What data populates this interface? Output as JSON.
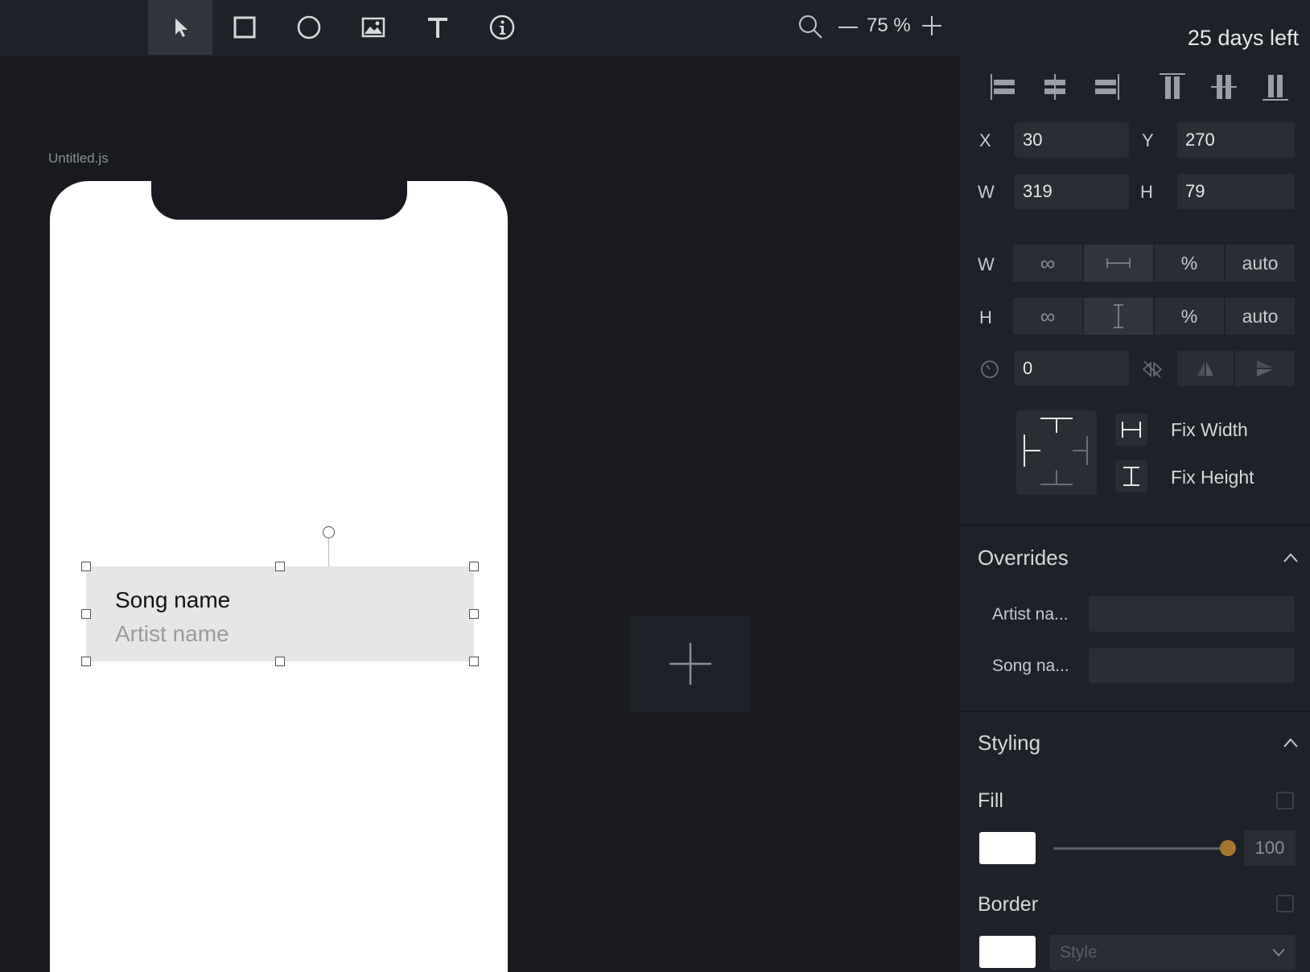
{
  "toolbar": {
    "tools": [
      {
        "name": "select-tool",
        "icon": "cursor-icon",
        "active": true
      },
      {
        "name": "rectangle-tool",
        "icon": "square-icon"
      },
      {
        "name": "oval-tool",
        "icon": "circle-icon"
      },
      {
        "name": "image-tool",
        "icon": "image-icon"
      },
      {
        "name": "text-tool",
        "icon": "text-icon"
      },
      {
        "name": "info-tool",
        "icon": "info-icon"
      }
    ],
    "zoom": "75 %"
  },
  "canvas": {
    "file_label": "Untitled.js",
    "component": {
      "song": "Song name",
      "artist": "Artist name"
    }
  },
  "inspector": {
    "trial": "25 days left",
    "x_label": "X",
    "x_value": "30",
    "y_label": "Y",
    "y_value": "270",
    "w_label": "W",
    "w_value": "319",
    "h_label": "H",
    "h_value": "79",
    "width_mode_label": "W",
    "height_mode_label": "H",
    "percent": "%",
    "auto": "auto",
    "rotation_value": "0",
    "fix_width": "Fix Width",
    "fix_height": "Fix Height",
    "overrides": {
      "title": "Overrides",
      "artist_label": "Artist na...",
      "song_label": "Song na..."
    },
    "styling": {
      "title": "Styling",
      "fill_label": "Fill",
      "fill_opacity": "100",
      "fill_opacity_level": 1.0,
      "border_label": "Border",
      "style_placeholder": "Style"
    }
  },
  "colors": {
    "accent_knob": "#a8752e",
    "panel_bg": "#1e2128",
    "canvas_bg": "#181a20"
  }
}
